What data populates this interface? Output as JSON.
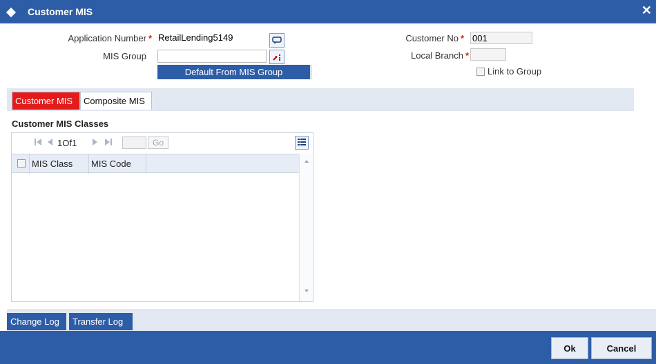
{
  "window": {
    "title": "Customer MIS",
    "close_glyph": "✕"
  },
  "form": {
    "application_number_label": "Application Number",
    "application_number_value": "RetailLending5149",
    "mis_group_label": "MIS Group",
    "mis_group_value": "",
    "default_button_label": "Default From MIS Group",
    "customer_no_label": "Customer No",
    "customer_no_value": "001",
    "local_branch_label": "Local Branch",
    "local_branch_value": "",
    "link_to_group_label": "Link to Group",
    "required_marker": "*"
  },
  "tabs": [
    {
      "label": "Customer MIS",
      "active": true
    },
    {
      "label": "Composite MIS",
      "active": false
    }
  ],
  "section": {
    "title": "Customer MIS Classes"
  },
  "grid": {
    "page_indicator": "1Of1",
    "go_label": "Go",
    "go_value": "",
    "columns": [
      "MIS Class",
      "MIS Code"
    ],
    "rows": []
  },
  "bottom_buttons": [
    "Change Log",
    "Transfer Log"
  ],
  "footer": {
    "ok_label": "Ok",
    "cancel_label": "Cancel"
  },
  "colors": {
    "header_blue": "#2e5da8",
    "active_tab_red": "#e41b1b",
    "required_red": "#d21111"
  },
  "icons": [
    "diamond-icon",
    "close-icon",
    "lov-chat-icon",
    "lov-pick-icon",
    "first-page-icon",
    "prev-page-icon",
    "next-page-icon",
    "last-page-icon",
    "grid-settings-icon",
    "scroll-up-icon",
    "scroll-down-icon"
  ]
}
